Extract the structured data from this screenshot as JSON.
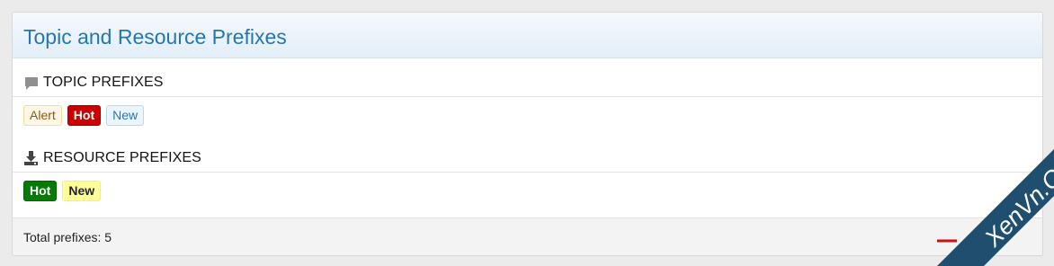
{
  "panel": {
    "title": "Topic and Resource Prefixes"
  },
  "sections": [
    {
      "icon": "comment-icon",
      "title": "TOPIC PREFIXES",
      "prefixes": [
        {
          "label": "Alert",
          "style": "alert"
        },
        {
          "label": "Hot",
          "style": "red"
        },
        {
          "label": "New",
          "style": "light-blue"
        }
      ]
    },
    {
      "icon": "download-icon",
      "title": "RESOURCE PREFIXES",
      "prefixes": [
        {
          "label": "Hot",
          "style": "green"
        },
        {
          "label": "New",
          "style": "yellow"
        }
      ]
    }
  ],
  "footer": {
    "total_text": "Total prefixes: 5"
  },
  "watermark": {
    "text": "XenVn.Com"
  },
  "colors": {
    "title": "#2577b1",
    "hot_red": "#cc0000",
    "hot_green": "#077a07",
    "new_yellow": "#ffff99",
    "watermark_band": "#1f4e6e"
  }
}
